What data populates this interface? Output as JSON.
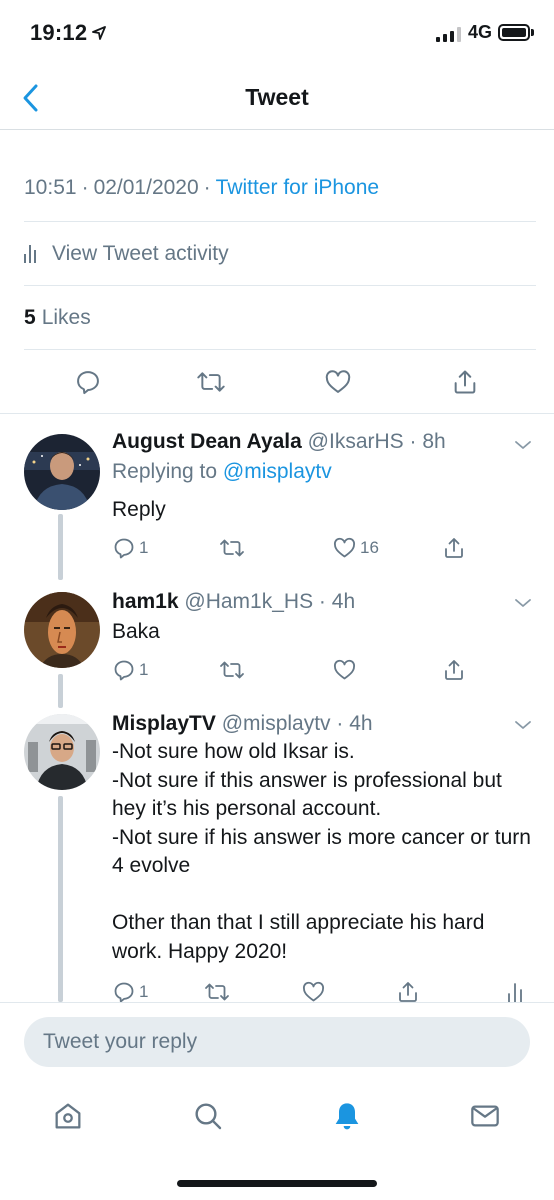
{
  "status_bar": {
    "time": "19:12",
    "network": "4G"
  },
  "header": {
    "title": "Tweet",
    "back_icon": "chevron-left-icon"
  },
  "tweet_meta": {
    "time": "10:51",
    "separator": "·",
    "date": "02/01/2020",
    "source": "Twitter for iPhone"
  },
  "activity": {
    "label": "View Tweet activity"
  },
  "likes": {
    "count": "5",
    "label": "Likes"
  },
  "actions": [
    "reply-icon",
    "retweet-icon",
    "like-icon",
    "share-icon"
  ],
  "replies": [
    {
      "name": "August Dean Ayala",
      "handle": "@IksarHS",
      "separator": "·",
      "age": "8h",
      "replying_prefix": "Replying to",
      "replying_to": "@misplaytv",
      "text": "Reply",
      "reply_count": "1",
      "retweet_count": "",
      "like_count": "16"
    },
    {
      "name": "ham1k",
      "handle": "@Ham1k_HS",
      "separator": "·",
      "age": "4h",
      "text": "Baka",
      "reply_count": "1",
      "retweet_count": "",
      "like_count": ""
    },
    {
      "name": "MisplayTV",
      "handle": "@misplaytv",
      "separator": "·",
      "age": "4h",
      "text": "-Not sure how old Iksar is.\n-Not sure if this answer is professional but hey it’s his personal account.\n-Not sure if his answer is more cancer or turn 4 evolve\n\nOther than that I still appreciate his hard work. Happy 2020!",
      "reply_count": "1",
      "retweet_count": "",
      "like_count": ""
    }
  ],
  "composer": {
    "placeholder": "Tweet your reply"
  },
  "tab_bar": {
    "items": [
      "home-icon",
      "search-icon",
      "notifications-icon",
      "messages-icon"
    ],
    "active": "notifications-icon"
  },
  "colors": {
    "accent": "#1b95e0",
    "text": "#14171a",
    "secondary": "#657786",
    "divider": "#e1e8ed"
  }
}
